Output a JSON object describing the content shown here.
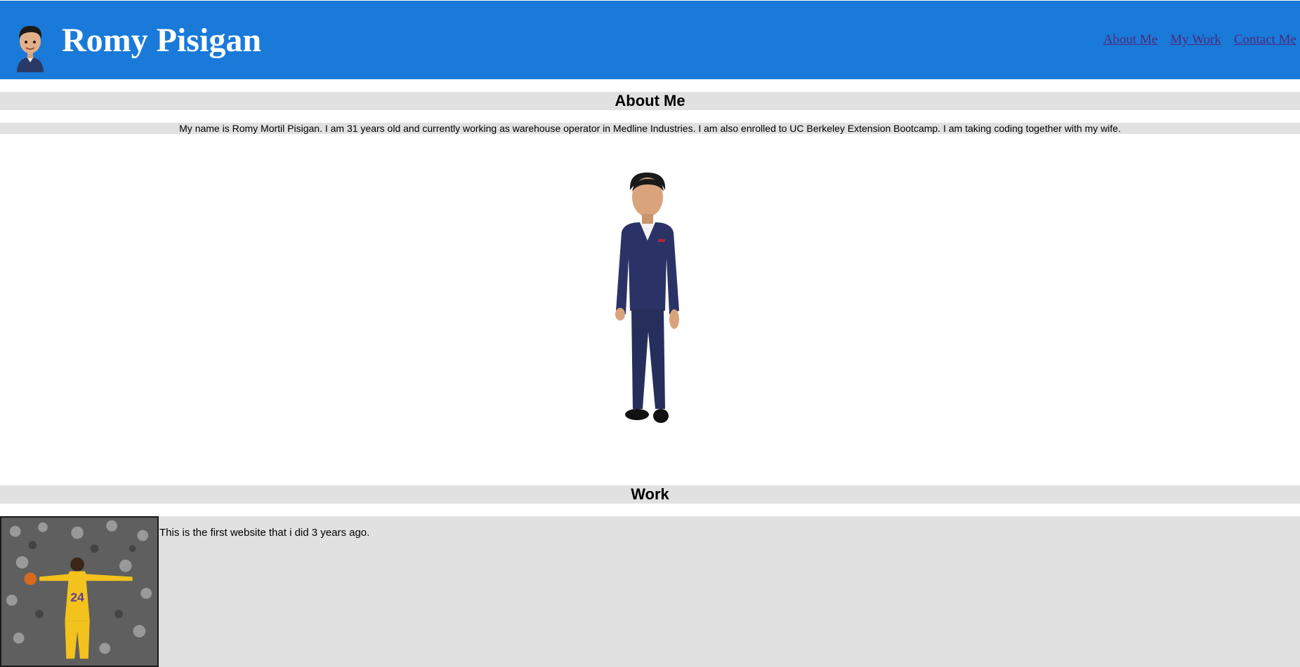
{
  "header": {
    "title": "Romy Pisigan",
    "nav": [
      {
        "label": "About Me"
      },
      {
        "label": "My Work"
      },
      {
        "label": "Contact Me"
      }
    ]
  },
  "about": {
    "heading": "About Me",
    "text": "My name is Romy Mortil Pisigan. I am 31 years old and currently working as warehouse operator in Medline Industries. I am also enrolled to UC Berkeley Extension Bootcamp. I am taking coding together with my wife."
  },
  "work": {
    "heading": "Work",
    "items": [
      {
        "text": "This is the first website that i did 3 years ago.",
        "jersey_number": "24"
      }
    ]
  },
  "colors": {
    "header_bg": "#1a7ad9",
    "section_bg": "#e1e1e1",
    "link_color": "#4b2a7b"
  }
}
